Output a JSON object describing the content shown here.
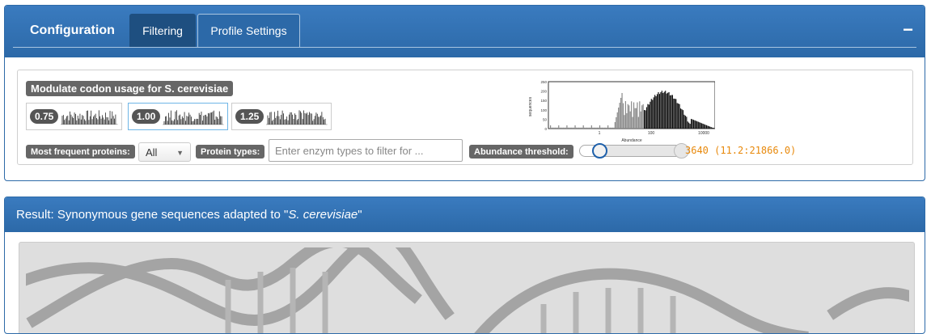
{
  "config": {
    "title": "Configuration",
    "tabs": [
      {
        "label": "Filtering"
      },
      {
        "label": "Profile Settings"
      }
    ],
    "collapse_label": "−"
  },
  "codon": {
    "title": "Modulate codon usage for S. cerevisiae",
    "options": [
      {
        "value": "0.75"
      },
      {
        "value": "1.00"
      },
      {
        "value": "1.25"
      }
    ],
    "selected": "1.00"
  },
  "histogram": {
    "ylabel": "sequences",
    "xlabel": "Abundance",
    "yticks": [
      "250",
      "200",
      "150",
      "100",
      "50",
      "0"
    ],
    "xticks": [
      "1",
      "100",
      "10000"
    ]
  },
  "filters": {
    "most_frequent_label": "Most frequent proteins:",
    "most_frequent_value": "All",
    "protein_types_label": "Protein types:",
    "protein_types_placeholder": "Enter enzym types to filter for ...",
    "abundance_label": "Abundance threshold:",
    "abundance_value_text": "3640 (11.2:21866.0)",
    "abundance_fraction": 0.2
  },
  "result": {
    "title_prefix": "Result: Synonymous gene sequences adapted to \"",
    "title_species": "S. cerevisiae",
    "title_suffix": "\""
  },
  "colors": {
    "panel_header": "#2c69a8",
    "accent_value": "#e8890c"
  }
}
